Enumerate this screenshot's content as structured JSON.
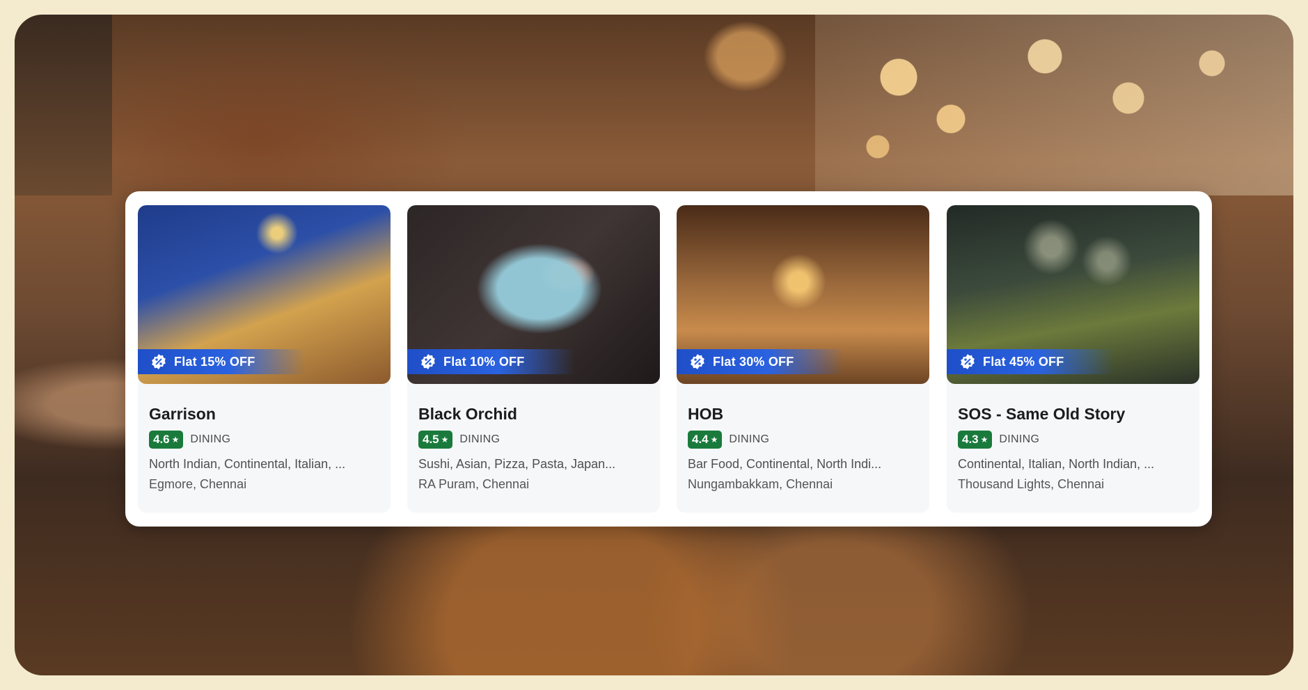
{
  "restaurants": [
    {
      "name": "Garrison",
      "rating": "4.6",
      "category": "DINING",
      "cuisines": "North Indian, Continental, Italian, ...",
      "location": "Egmore, Chennai",
      "offer": "Flat 15% OFF"
    },
    {
      "name": "Black Orchid",
      "rating": "4.5",
      "category": "DINING",
      "cuisines": "Sushi, Asian, Pizza, Pasta, Japan...",
      "location": "RA Puram, Chennai",
      "offer": "Flat 10% OFF"
    },
    {
      "name": "HOB",
      "rating": "4.4",
      "category": "DINING",
      "cuisines": "Bar Food, Continental, North Indi...",
      "location": "Nungambakkam, Chennai",
      "offer": "Flat 30% OFF"
    },
    {
      "name": "SOS - Same Old Story",
      "rating": "4.3",
      "category": "DINING",
      "cuisines": "Continental, Italian, North Indian, ...",
      "location": "Thousand Lights, Chennai",
      "offer": "Flat 45% OFF"
    }
  ],
  "colors": {
    "rating_badge": "#1a7a3c",
    "offer_banner": "#2a62e0",
    "page_background": "#f4ebcf"
  },
  "icons": {
    "offer": "discount-badge-icon",
    "rating": "star-icon"
  }
}
